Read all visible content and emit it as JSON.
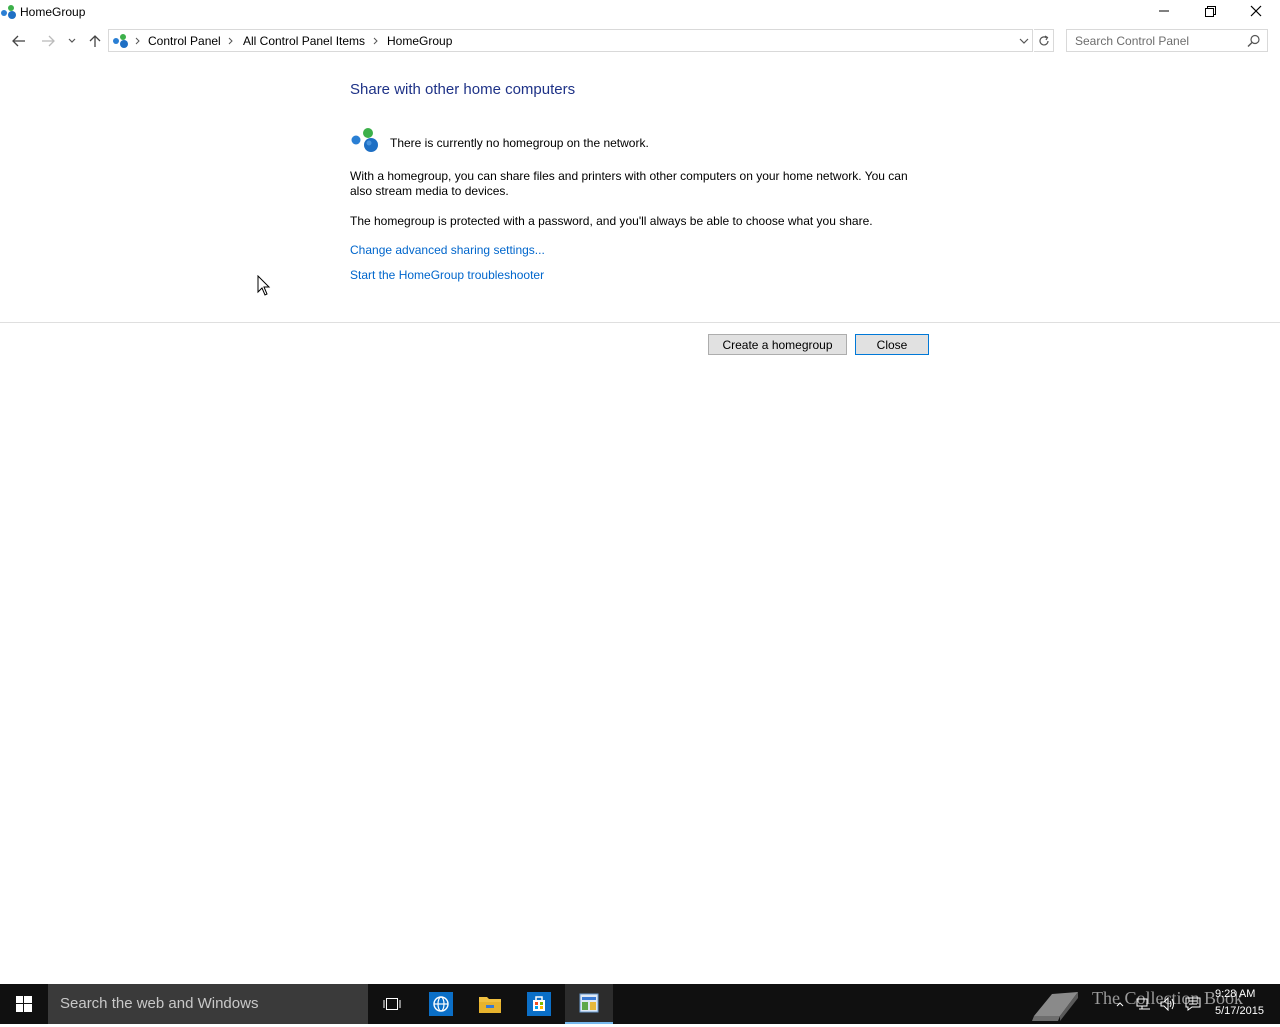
{
  "window": {
    "title": "HomeGroup"
  },
  "address": {
    "crumbs": [
      "Control Panel",
      "All Control Panel Items",
      "HomeGroup"
    ],
    "search_placeholder": "Search Control Panel"
  },
  "main": {
    "heading": "Share with other home computers",
    "status": "There is currently no homegroup on the network.",
    "description": "With a homegroup, you can share files and printers with other computers on your home network. You can also stream media to devices.",
    "password_note": "The homegroup is protected with a password, and you'll always be able to choose what you share.",
    "links": {
      "advanced_sharing": "Change advanced sharing settings...",
      "troubleshooter": "Start the HomeGroup troubleshooter"
    },
    "buttons": {
      "create": "Create a homegroup",
      "close": "Close"
    }
  },
  "taskbar": {
    "search_text": "Search the web and Windows",
    "watermark": "The Collection Book",
    "time": "9:28 AM",
    "date": "5/17/2015"
  },
  "colors": {
    "heading": "#1e3287",
    "link": "#0066cc",
    "taskbar": "#101010",
    "accent": "#0078d7"
  }
}
